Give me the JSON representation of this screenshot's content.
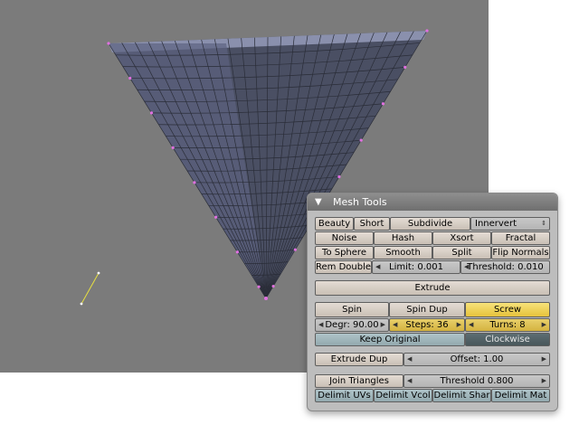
{
  "panel": {
    "title": "Mesh Tools",
    "row1": {
      "beauty": "Beauty",
      "short": "Short",
      "subdivide": "Subdivide",
      "innervert": "Innervert"
    },
    "row2": {
      "noise": "Noise",
      "hash": "Hash",
      "xsort": "Xsort",
      "fractal": "Fractal"
    },
    "row3": {
      "to_sphere": "To Sphere",
      "smooth": "Smooth",
      "split": "Split",
      "flip_normals": "Flip Normals"
    },
    "row4": {
      "rem_double": "Rem Double",
      "limit": "Limit: 0.001",
      "threshold": "Threshold: 0.010"
    },
    "extrude": "Extrude",
    "spin_row": {
      "spin": "Spin",
      "spin_dup": "Spin Dup",
      "screw": "Screw"
    },
    "param_row": {
      "degr": "Degr: 90.00",
      "steps": "Steps: 36",
      "turns": "Turns: 8"
    },
    "toggle_row": {
      "keep_original": "Keep Original",
      "clockwise": "Clockwise"
    },
    "extrude_dup_row": {
      "extrude_dup": "Extrude Dup",
      "offset": "Offset: 1.00"
    },
    "join_row": {
      "join_triangles": "Join Triangles",
      "threshold": "Threshold 0.800"
    },
    "delimit_row": {
      "uvs": "Delimit UVs",
      "vcol": "Delimit Vcol",
      "shar": "Delimit Shar",
      "mat": "Delimit Mat"
    }
  },
  "colors": {
    "viewport_bg": "#7b7b7b",
    "mesh_face": "#4a4f63",
    "mesh_edge": "#2a2d38",
    "vertex_selected": "#e070e0",
    "panel_bg": "#bdbdbd",
    "screw_active": "#f0d25a"
  }
}
